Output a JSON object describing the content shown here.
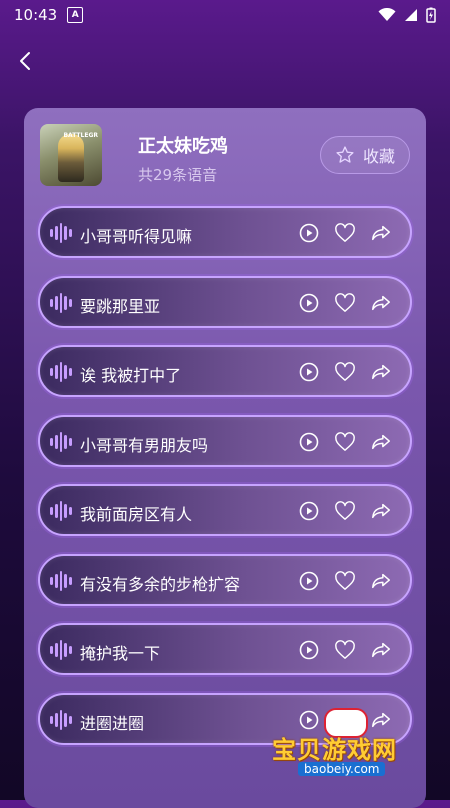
{
  "status": {
    "time": "10:43",
    "notif": "A"
  },
  "album": {
    "title": "正太妹吃鸡",
    "count_label": "共29条语音",
    "favorite_label": "收藏",
    "cover_logo": "BATTLEGR"
  },
  "items": [
    {
      "label": "小哥哥听得见嘛"
    },
    {
      "label": "要跳那里亚"
    },
    {
      "label": "诶 我被打中了"
    },
    {
      "label": "小哥哥有男朋友吗"
    },
    {
      "label": "我前面房区有人"
    },
    {
      "label": "有没有多余的步枪扩容"
    },
    {
      "label": "掩护我一下"
    },
    {
      "label": "进圈进圈"
    }
  ],
  "watermark": {
    "text": "宝贝游戏网",
    "url": "baobeiy.com"
  },
  "colors": {
    "accent": "#c7a4ff",
    "panel": "#7a57ad",
    "watermark": "#ffcc33"
  }
}
